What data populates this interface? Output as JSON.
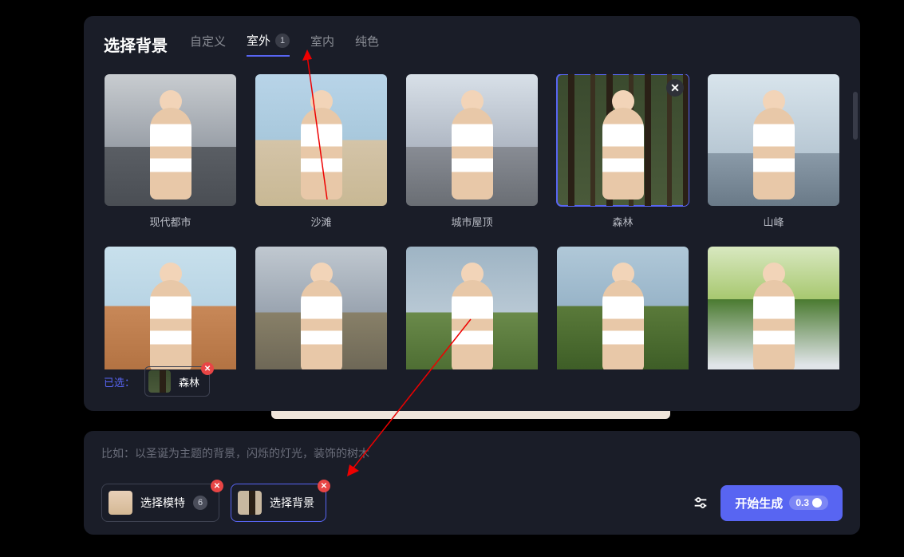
{
  "panel": {
    "title": "选择背景",
    "tabs": [
      {
        "label": "自定义",
        "active": false,
        "badge": null
      },
      {
        "label": "室外",
        "active": true,
        "badge": "1"
      },
      {
        "label": "室内",
        "active": false,
        "badge": null
      },
      {
        "label": "纯色",
        "active": false,
        "badge": null
      }
    ],
    "cards_row1": [
      {
        "label": "现代都市",
        "bg": "bg-city",
        "selected": false
      },
      {
        "label": "沙滩",
        "bg": "bg-beach",
        "selected": false
      },
      {
        "label": "城市屋顶",
        "bg": "bg-roof",
        "selected": false
      },
      {
        "label": "森林",
        "bg": "bg-forest",
        "selected": true
      },
      {
        "label": "山峰",
        "bg": "bg-peak",
        "selected": false
      }
    ],
    "cards_row2": [
      {
        "label": "",
        "bg": "bg-desert"
      },
      {
        "label": "",
        "bg": "bg-village"
      },
      {
        "label": "",
        "bg": "bg-grass"
      },
      {
        "label": "",
        "bg": "bg-vine"
      },
      {
        "label": "",
        "bg": "bg-park"
      }
    ],
    "selected_label": "已选：",
    "selected_item": "森林"
  },
  "bottom": {
    "example": "比如：以圣诞为主题的背景，闪烁的灯光，装饰的树木",
    "pills": [
      {
        "label": "选择模特",
        "badge": "6",
        "active": false,
        "thumb": "face"
      },
      {
        "label": "选择背景",
        "badge": null,
        "active": true,
        "thumb": "forest"
      }
    ],
    "generate_label": "开始生成",
    "generate_cost": "0.3"
  }
}
